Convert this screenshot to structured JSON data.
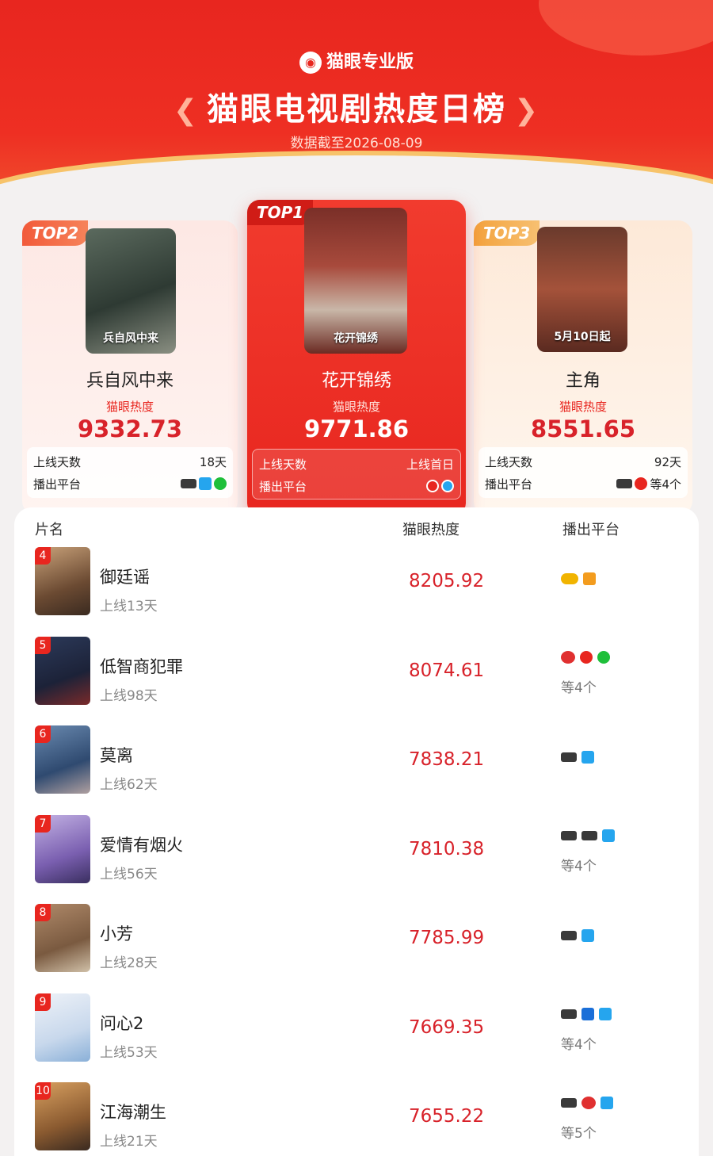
{
  "header": {
    "brand": "猫眼专业版",
    "title": "猫眼电视剧热度日榜",
    "laurel_left": "《",
    "laurel_right": "》",
    "date_text": "数据截至2026-08-09"
  },
  "colors": {
    "accent": "#e8261f",
    "heat": "#d8222a"
  },
  "top3": [
    {
      "rank_label": "TOP2",
      "name": "兵自风中来",
      "poster_text": "兵自风中来",
      "heat_label": "猫眼热度",
      "heat": "9332.73",
      "days_label": "上线天数",
      "days": "18天",
      "platform_label": "播出平台",
      "platforms": [
        "cctv-icon",
        "tencent-icon",
        "iqiyi-icon"
      ],
      "more": ""
    },
    {
      "rank_label": "TOP1",
      "name": "花开锦绣",
      "poster_text": "花开锦绣",
      "heat_label": "猫眼热度",
      "heat": "9771.86",
      "days_label": "上线天数",
      "days": "上线首日",
      "platform_label": "播出平台",
      "platforms": [
        "youku-icon",
        "tencent-icon"
      ],
      "more": ""
    },
    {
      "rank_label": "TOP3",
      "name": "主角",
      "poster_text": "5月10日起",
      "heat_label": "猫眼热度",
      "heat": "8551.65",
      "days_label": "上线天数",
      "days": "92天",
      "platform_label": "播出平台",
      "platforms": [
        "cctv-icon",
        "youku-icon"
      ],
      "more": "等4个"
    }
  ],
  "list": {
    "col_name": "片名",
    "col_heat": "猫眼热度",
    "col_platform": "播出平台",
    "rows": [
      {
        "rank": "4",
        "name": "御廷谣",
        "days": "上线13天",
        "heat": "8205.92",
        "platforms": [
          "hunan-icon",
          "mango-icon"
        ],
        "more": ""
      },
      {
        "rank": "5",
        "name": "低智商犯罪",
        "days": "上线98天",
        "heat": "8074.61",
        "platforms": [
          "dragon-icon",
          "youku-icon",
          "iqiyi-icon"
        ],
        "more": "等4个"
      },
      {
        "rank": "6",
        "name": "莫离",
        "days": "上线62天",
        "heat": "7838.21",
        "platforms": [
          "cctv-icon",
          "tencent-icon"
        ],
        "more": ""
      },
      {
        "rank": "7",
        "name": "爱情有烟火",
        "days": "上线56天",
        "heat": "7810.38",
        "platforms": [
          "cctv-icon",
          "cctv-icon",
          "tencent-icon"
        ],
        "more": "等4个"
      },
      {
        "rank": "8",
        "name": "小芳",
        "days": "上线28天",
        "heat": "7785.99",
        "platforms": [
          "cctv-icon",
          "tencent-icon"
        ],
        "more": ""
      },
      {
        "rank": "9",
        "name": "问心2",
        "days": "上线53天",
        "heat": "7669.35",
        "platforms": [
          "cctv-icon",
          "zjtv-icon",
          "tencent-icon"
        ],
        "more": "等4个"
      },
      {
        "rank": "10",
        "name": "江海潮生",
        "days": "上线21天",
        "heat": "7655.22",
        "platforms": [
          "cctv-icon",
          "dragon-icon",
          "tencent-icon"
        ],
        "more": "等5个"
      }
    ]
  }
}
